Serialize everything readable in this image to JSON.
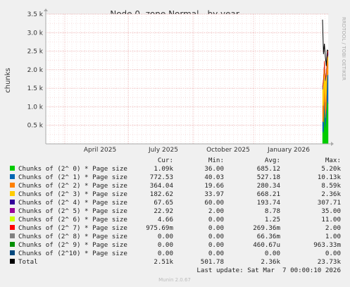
{
  "chart_data": {
    "type": "area",
    "title": "Node 0, zone Normal - by year",
    "xlabel": "",
    "ylabel": "chunks",
    "x_ticks": [
      "April 2025",
      "July 2025",
      "October 2025",
      "January 2026"
    ],
    "y_ticks": [
      "0.5 k",
      "1.0 k",
      "1.5 k",
      "2.0 k",
      "2.5 k",
      "3.0 k",
      "3.5 k"
    ],
    "ylim": [
      0,
      3500
    ],
    "grid": true,
    "stacked": true,
    "series": [
      {
        "name": "Chunks of (2^ 0) * Page size",
        "color": "#00cc00",
        "cur": "1.09k",
        "min": "36.00",
        "avg": "685.12",
        "max": "5.20k"
      },
      {
        "name": "Chunks of (2^ 1) * Page size",
        "color": "#0066b3",
        "cur": "772.53",
        "min": "40.03",
        "avg": "527.18",
        "max": "10.13k"
      },
      {
        "name": "Chunks of (2^ 2) * Page size",
        "color": "#ff8000",
        "cur": "364.04",
        "min": "19.66",
        "avg": "280.34",
        "max": "8.59k"
      },
      {
        "name": "Chunks of (2^ 3) * Page size",
        "color": "#ffcc00",
        "cur": "182.62",
        "min": "33.97",
        "avg": "668.21",
        "max": "2.36k"
      },
      {
        "name": "Chunks of (2^ 4) * Page size",
        "color": "#330099",
        "cur": "67.65",
        "min": "60.00",
        "avg": "193.74",
        "max": "307.71"
      },
      {
        "name": "Chunks of (2^ 5) * Page size",
        "color": "#990099",
        "cur": "22.92",
        "min": "2.00",
        "avg": "8.78",
        "max": "35.00"
      },
      {
        "name": "Chunks of (2^ 6) * Page size",
        "color": "#ccff00",
        "cur": "4.66",
        "min": "0.00",
        "avg": "1.25",
        "max": "11.00"
      },
      {
        "name": "Chunks of (2^ 7) * Page size",
        "color": "#ff0000",
        "cur": "975.69m",
        "min": "0.00",
        "avg": "269.36m",
        "max": "2.00"
      },
      {
        "name": "Chunks of (2^ 8) * Page size",
        "color": "#808080",
        "cur": "0.00",
        "min": "0.00",
        "avg": "66.36m",
        "max": "1.00"
      },
      {
        "name": "Chunks of (2^ 9) * Page size",
        "color": "#008f00",
        "cur": "0.00",
        "min": "0.00",
        "avg": "460.67u",
        "max": "963.33m"
      },
      {
        "name": "Chunks of (2^10) * Page size",
        "color": "#00487d",
        "cur": "0.00",
        "min": "0.00",
        "avg": "0.00",
        "max": "0.00"
      }
    ],
    "total": {
      "name": "Total",
      "color": "#000000",
      "cur": "2.51k",
      "min": "501.78",
      "avg": "2.36k",
      "max": "23.73k"
    },
    "recent_spike": [
      {
        "t": 0.0,
        "vals": [
          350,
          260,
          430,
          430,
          50,
          15,
          3,
          1,
          0,
          0,
          0
        ]
      },
      {
        "t": 0.17,
        "vals": [
          300,
          280,
          450,
          650,
          60,
          18,
          4,
          1,
          0,
          0,
          0
        ]
      },
      {
        "t": 0.33,
        "vals": [
          1000,
          250,
          400,
          500,
          60,
          18,
          4,
          1,
          0,
          0,
          0
        ]
      },
      {
        "t": 0.5,
        "vals": [
          450,
          250,
          420,
          580,
          55,
          18,
          4,
          1,
          0,
          0,
          0
        ]
      },
      {
        "t": 0.67,
        "vals": [
          700,
          300,
          360,
          480,
          60,
          20,
          4,
          1,
          0,
          0,
          0
        ]
      },
      {
        "t": 0.83,
        "vals": [
          1200,
          650,
          300,
          150,
          65,
          22,
          5,
          1,
          0,
          0,
          0
        ]
      },
      {
        "t": 1.0,
        "vals": [
          1090,
          773,
          364,
          183,
          68,
          23,
          5,
          1,
          0,
          0,
          0
        ]
      }
    ],
    "total_spike": [
      3350,
      2420,
      2700,
      2350,
      2100,
      2530,
      2510
    ]
  },
  "legend_header": {
    "cur": "Cur:",
    "min": "Min:",
    "avg": "Avg:",
    "max": "Max:"
  },
  "last_update": "Last update: Sat Mar  7 00:00:10 2026",
  "side_label": "RRDTOOL / TOBI OETIKER",
  "footer": "Munin 2.0.67"
}
